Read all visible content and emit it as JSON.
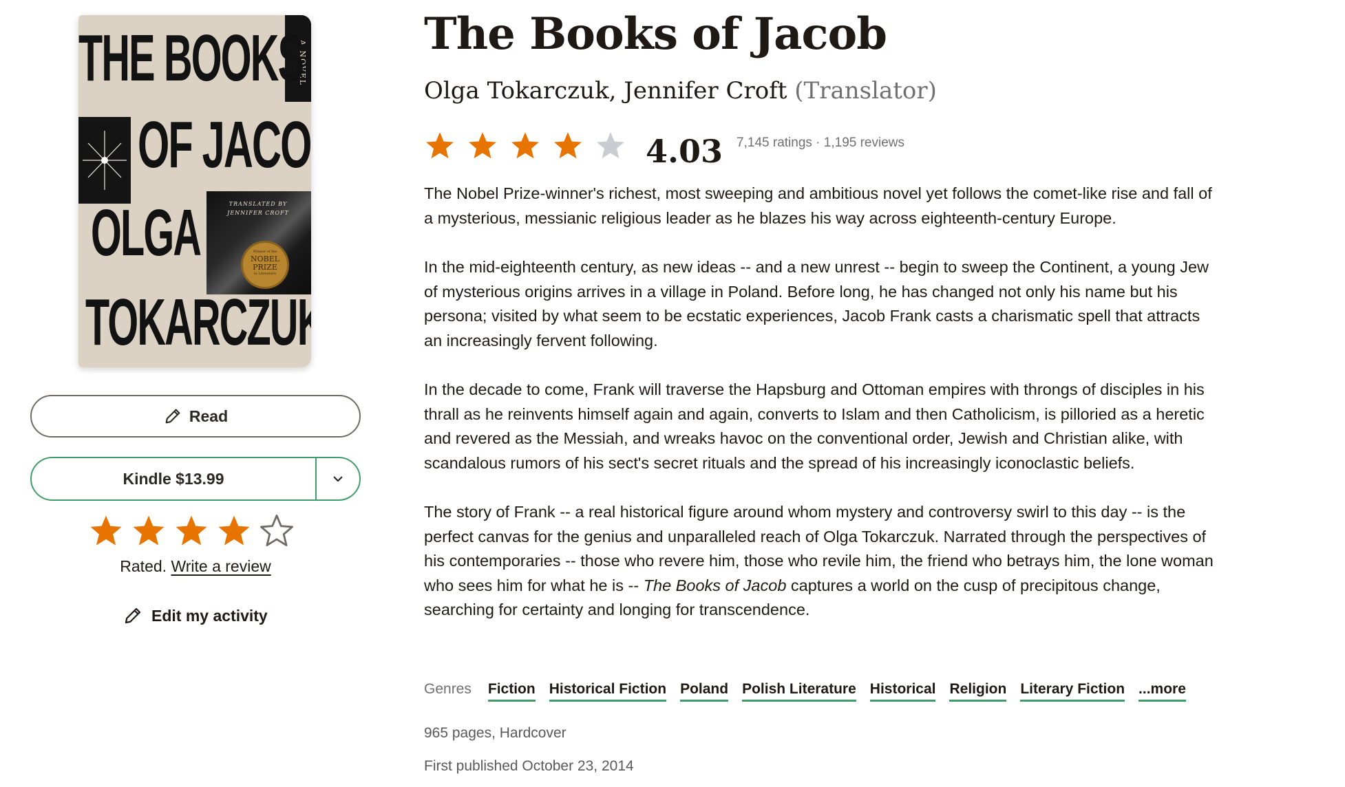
{
  "book": {
    "title": "The Books of Jacob",
    "author": "Olga Tokarczuk, Jennifer Croft",
    "author_role": "(Translator)",
    "average_rating": "4.03",
    "average_stars": 4,
    "ratings_summary": "7,145 ratings · 1,195 reviews",
    "description": [
      "The Nobel Prize-winner's richest, most sweeping and ambitious novel yet follows the comet-like rise and fall of a mysterious, messianic religious leader as he blazes his way across eighteenth-century Europe.",
      "In the mid-eighteenth century, as new ideas -- and a new unrest -- begin to sweep the Continent, a young Jew of mysterious origins arrives in a village in Poland. Before long, he has changed not only his name but his persona; visited by what seem to be ecstatic experiences, Jacob Frank casts a charismatic spell that attracts an increasingly fervent following.",
      "In the decade to come, Frank will traverse the Hapsburg and Ottoman empires with throngs of disciples in his thrall as he reinvents himself again and again, converts to Islam and then Catholicism, is pilloried as a heretic and revered as the Messiah, and wreaks havoc on the conventional order, Jewish and Christian alike, with scandalous rumors of his sect's secret rituals and the spread of his increasingly iconoclastic beliefs."
    ],
    "description_last": {
      "before": "The story of Frank -- a real historical figure around whom mystery and controversy swirl to this day -- is the perfect canvas for the genius and unparalleled reach of Olga Tokarczuk. Narrated through the perspectives of his contemporaries -- those who revere him, those who revile him, the friend who betrays him, the lone woman who sees him for what he is -- ",
      "italic": "The Books of Jacob",
      "after": " captures a world on the cusp of precipitous change, searching for certainty and longing for transcendence."
    },
    "genres_label": "Genres",
    "genres": [
      "Fiction",
      "Historical Fiction",
      "Poland",
      "Polish Literature",
      "Historical",
      "Religion",
      "Literary Fiction",
      "...more"
    ],
    "pages_format": "965 pages, Hardcover",
    "first_published": "First published October 23, 2014"
  },
  "cover": {
    "line1": "THE BOOKS",
    "line2": "OF JACOB",
    "line3": "OLGA",
    "line4": "TOKARCZUK",
    "spine": "A NOVEL",
    "translated_by": "TRANSLATED BY",
    "translator": "JENNIFER CROFT",
    "medal_top": "Winner of the",
    "medal_main": "NOBEL PRIZE",
    "medal_bottom": "in Literature"
  },
  "actions": {
    "read_label": "Read",
    "kindle_label": "Kindle $13.99",
    "user_stars": 4,
    "rated_text": "Rated.",
    "write_review": "Write a review",
    "edit_activity": "Edit my activity"
  },
  "colors": {
    "star_filled": "#e87400",
    "star_empty_grey": "#c9cdd2",
    "accent_green": "#409d69",
    "text": "#1e1915",
    "muted": "#707070"
  }
}
